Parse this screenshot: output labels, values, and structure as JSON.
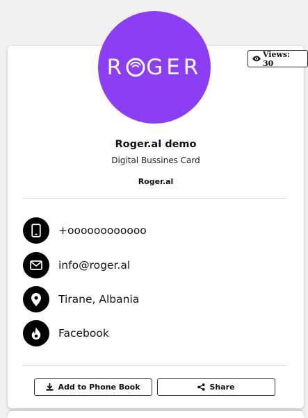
{
  "views": {
    "icon": "eye-icon",
    "label": "Views: 30"
  },
  "profile": {
    "logo_text": "ROGER",
    "avatar_color": "#8c3ef5",
    "name": "Roger.al demo",
    "subtitle": "Digital Bussines Card",
    "company": "Roger.al"
  },
  "contacts": [
    {
      "icon": "mobile-phone-icon",
      "label": "+oooooooooooo"
    },
    {
      "icon": "envelope-icon",
      "label": "info@roger.al"
    },
    {
      "icon": "map-pin-icon",
      "label": "Tirane, Albania"
    },
    {
      "icon": "flame-icon",
      "label": "Facebook"
    }
  ],
  "actions": {
    "add_label": "Add to Phone Book",
    "add_icon": "download-icon",
    "share_label": "Share",
    "share_icon": "share-icon"
  }
}
